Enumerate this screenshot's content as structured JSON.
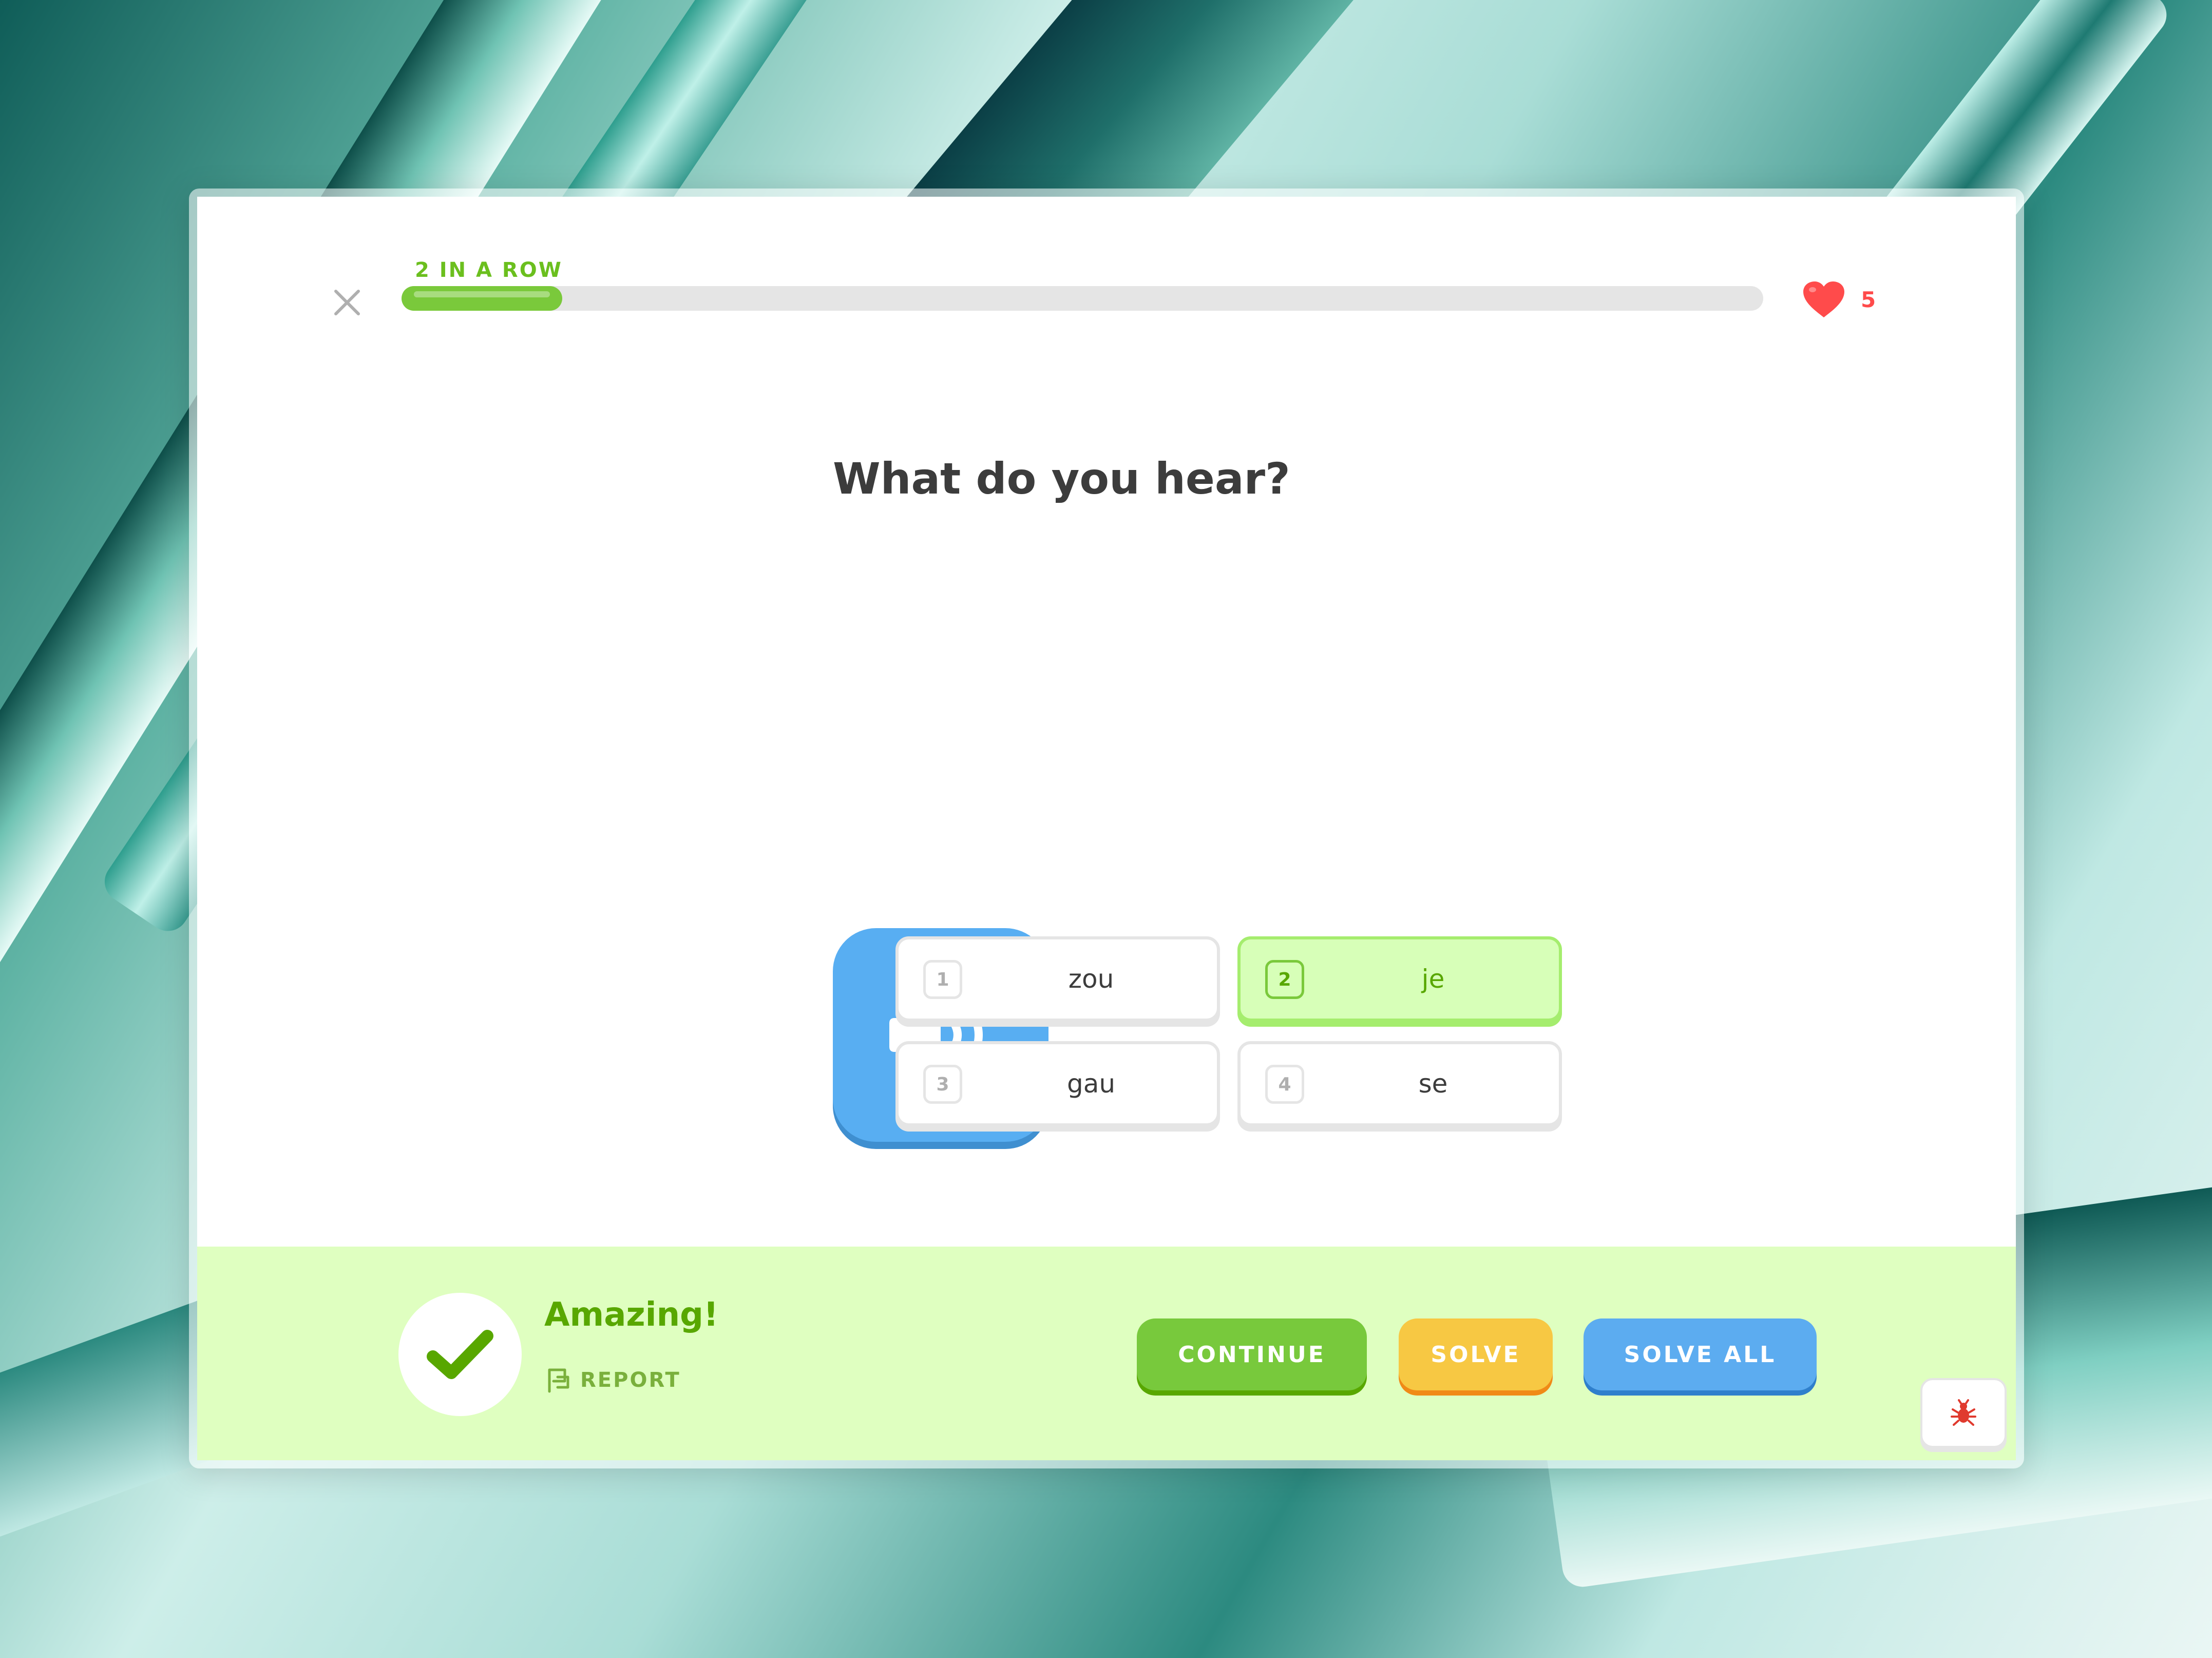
{
  "lesson": {
    "streak_label": "2 IN A ROW",
    "progress_fraction": 0.118,
    "hearts_count": "5",
    "question": "What do you hear?"
  },
  "options": [
    {
      "number": "1",
      "word": "zou",
      "selected": false
    },
    {
      "number": "2",
      "word": "je",
      "selected": true
    },
    {
      "number": "3",
      "word": "gau",
      "selected": false
    },
    {
      "number": "4",
      "word": "se",
      "selected": false
    }
  ],
  "footer": {
    "feedback_title": "Amazing!",
    "report_label": "REPORT",
    "continue_label": "CONTINUE",
    "solve_label": "SOLVE",
    "solve_all_label": "SOLVE ALL"
  },
  "icons": {
    "close": "close-icon",
    "heart": "heart-icon",
    "speaker": "speaker-icon",
    "check": "checkmark-icon",
    "report": "flag-icon",
    "debug": "bug-icon"
  },
  "colors": {
    "correct_green": "#58a700",
    "footer_bg": "#dfffc0",
    "heart_red": "#ff4b4b",
    "speaker_blue": "#58aef2",
    "solve_yellow": "#f7c843",
    "solve_all_blue": "#5cacf0"
  }
}
